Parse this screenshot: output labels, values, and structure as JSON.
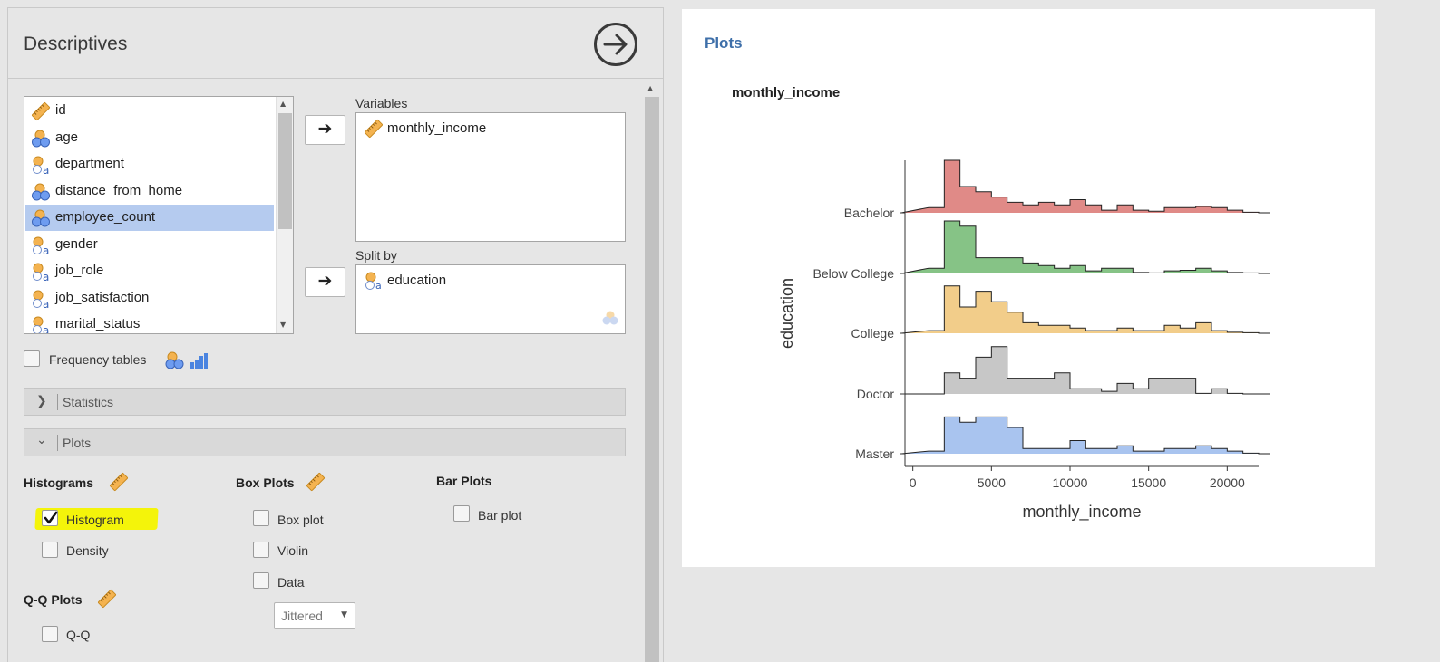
{
  "analysis": {
    "title": "Descriptives"
  },
  "variables_list": [
    {
      "name": "id",
      "type": "continuous"
    },
    {
      "name": "age",
      "type": "nominal-int"
    },
    {
      "name": "department",
      "type": "nominal-text"
    },
    {
      "name": "distance_from_home",
      "type": "nominal-int"
    },
    {
      "name": "employee_count",
      "type": "nominal-int",
      "selected": true
    },
    {
      "name": "gender",
      "type": "nominal-text"
    },
    {
      "name": "job_role",
      "type": "nominal-text"
    },
    {
      "name": "job_satisfaction",
      "type": "nominal-text"
    },
    {
      "name": "marital_status",
      "type": "nominal-text"
    }
  ],
  "targets": {
    "variables_label": "Variables",
    "variables": [
      "monthly_income"
    ],
    "split_label": "Split by",
    "split": [
      "education"
    ]
  },
  "frequency_tables": {
    "label": "Frequency tables",
    "checked": false
  },
  "sections": {
    "statistics": "Statistics",
    "plots": "Plots"
  },
  "histograms": {
    "title": "Histograms",
    "histogram": {
      "label": "Histogram",
      "checked": true
    },
    "density": {
      "label": "Density",
      "checked": false
    }
  },
  "box_plots": {
    "title": "Box Plots",
    "box_plot": {
      "label": "Box plot",
      "checked": false
    },
    "violin": {
      "label": "Violin",
      "checked": false
    },
    "data": {
      "label": "Data",
      "checked": false
    },
    "data_type": "Jittered"
  },
  "bar_plots": {
    "title": "Bar Plots",
    "bar_plot": {
      "label": "Bar plot",
      "checked": false
    }
  },
  "qq_plots": {
    "title": "Q-Q Plots",
    "qq": {
      "label": "Q-Q",
      "checked": false
    }
  },
  "results": {
    "section_title": "Plots",
    "plot_title": "monthly_income"
  },
  "colors": {
    "bachelor": "#e08a87",
    "below_college": "#86c386",
    "college": "#f2cd8a",
    "doctor": "#c7c7c7",
    "master": "#a9c4ef",
    "accent": "#3e6fa9"
  },
  "chart_data": {
    "type": "area",
    "xlabel": "monthly_income",
    "ylabel": "education",
    "xlim": [
      -500,
      22000
    ],
    "x_ticks": [
      0,
      5000,
      10000,
      15000,
      20000
    ],
    "bins": [
      1000,
      2000,
      3000,
      4000,
      5000,
      6000,
      7000,
      8000,
      9000,
      10000,
      11000,
      12000,
      13000,
      14000,
      15000,
      16000,
      17000,
      18000,
      19000,
      20000,
      21000,
      22000
    ],
    "series": [
      {
        "name": "Bachelor",
        "color": "#e08a87",
        "counts": [
          0.1,
          1.0,
          0.5,
          0.4,
          0.3,
          0.2,
          0.15,
          0.2,
          0.15,
          0.25,
          0.15,
          0.05,
          0.15,
          0.05,
          0.03,
          0.1,
          0.1,
          0.12,
          0.1,
          0.05,
          0.01
        ]
      },
      {
        "name": "Below College",
        "color": "#86c386",
        "counts": [
          0.1,
          1.0,
          0.9,
          0.3,
          0.3,
          0.3,
          0.2,
          0.15,
          0.1,
          0.15,
          0.05,
          0.1,
          0.1,
          0.02,
          0.01,
          0.05,
          0.06,
          0.1,
          0.05,
          0.02,
          0.01
        ]
      },
      {
        "name": "College",
        "color": "#f2cd8a",
        "counts": [
          0.05,
          0.9,
          0.5,
          0.8,
          0.6,
          0.4,
          0.2,
          0.15,
          0.15,
          0.1,
          0.05,
          0.05,
          0.1,
          0.05,
          0.05,
          0.15,
          0.1,
          0.2,
          0.05,
          0.02,
          0.01
        ]
      },
      {
        "name": "Doctor",
        "color": "#c7c7c7",
        "counts": [
          0,
          0.4,
          0.3,
          0.7,
          0.9,
          0.3,
          0.3,
          0.3,
          0.4,
          0.1,
          0.1,
          0.05,
          0.2,
          0.1,
          0.3,
          0.3,
          0.3,
          0.01,
          0.1,
          0.01,
          0.0
        ]
      },
      {
        "name": "Master",
        "color": "#a9c4ef",
        "counts": [
          0.05,
          0.7,
          0.6,
          0.7,
          0.7,
          0.5,
          0.1,
          0.1,
          0.1,
          0.25,
          0.1,
          0.1,
          0.15,
          0.05,
          0.05,
          0.1,
          0.1,
          0.15,
          0.1,
          0.05,
          0.01
        ]
      }
    ]
  }
}
